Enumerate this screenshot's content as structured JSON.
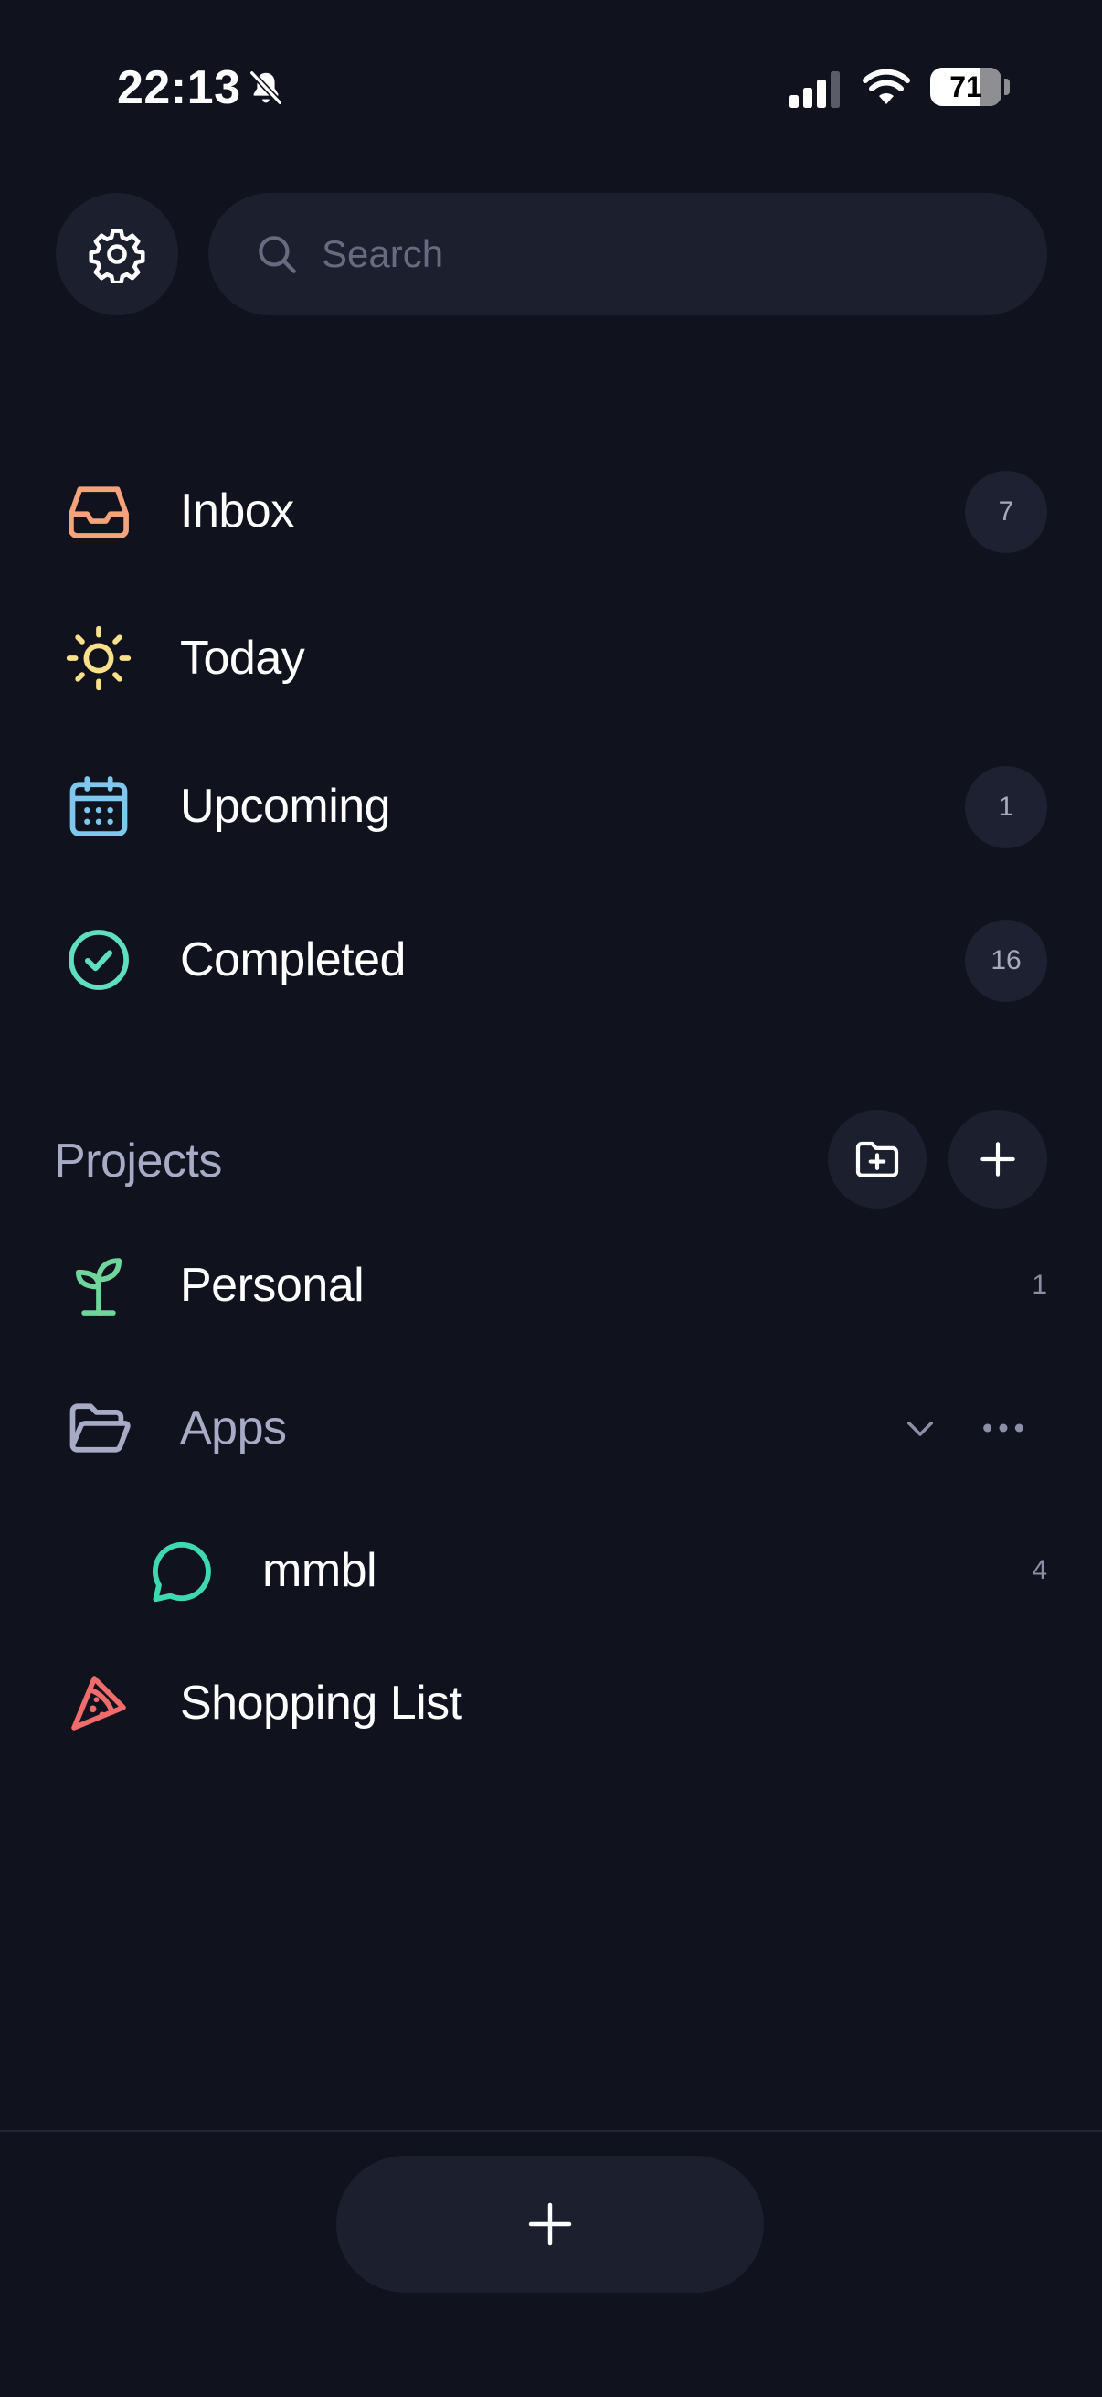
{
  "status_bar": {
    "time": "22:13",
    "battery_level": "71",
    "battery_fraction": 0.71,
    "icons": [
      "bell-slash-icon",
      "cellular-signal-icon",
      "wifi-icon",
      "battery-icon"
    ]
  },
  "header": {
    "settings_icon": "gear-icon",
    "search_placeholder": "Search",
    "search_value": "",
    "search_icon": "search-icon"
  },
  "nav": [
    {
      "label": "Inbox",
      "count": "7",
      "icon": "inbox-tray-icon",
      "color": "#f4a37c"
    },
    {
      "label": "Today",
      "count": "",
      "icon": "sun-icon",
      "color": "#f9e08b"
    },
    {
      "label": "Upcoming",
      "count": "1",
      "icon": "calendar-icon",
      "color": "#7ec8f0"
    },
    {
      "label": "Completed",
      "count": "16",
      "icon": "check-circle-icon",
      "color": "#5ee0c0"
    }
  ],
  "projects": {
    "title": "Projects",
    "actions": [
      "folder-plus-icon",
      "plus-icon"
    ],
    "items": [
      {
        "label": "Personal",
        "count": "1",
        "icon": "sprout-icon",
        "color": "#6fd59a"
      },
      {
        "label": "Apps",
        "count": "",
        "icon": "folder-open-icon",
        "color": "#a8abc6",
        "expanded": true
      },
      {
        "label": "mmbl",
        "count": "4",
        "icon": "chat-bubble-icon",
        "color": "#3fd9b0"
      },
      {
        "label": "Shopping List",
        "count": "",
        "icon": "pizza-slice-icon",
        "color": "#f06c6c"
      }
    ]
  },
  "footer": {
    "add_icon": "plus-icon"
  }
}
